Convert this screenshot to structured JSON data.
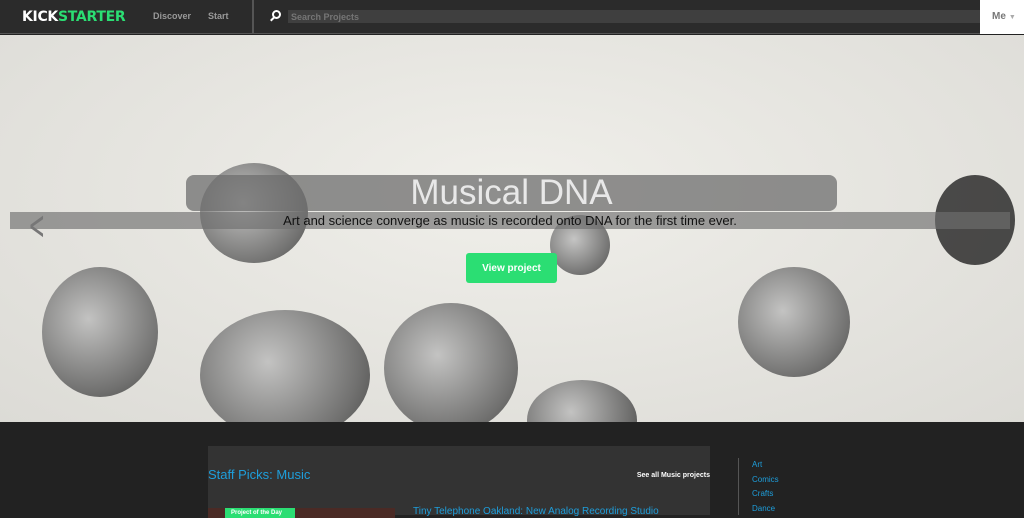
{
  "nav": {
    "logo_a": "KICK",
    "logo_b": "STARTER",
    "discover": "Discover",
    "start": "Start",
    "search_placeholder": "Search Projects",
    "me": "Me"
  },
  "hero": {
    "title": "Musical DNA",
    "subtitle": "Art and science converge as music is recorded onto DNA for the first time ever.",
    "button": "View project"
  },
  "staff": {
    "heading": "Staff Picks: Music",
    "see_all": "See all Music projects",
    "badge": "Project of the Day",
    "project_title": "Tiny Telephone Oakland: New Analog Recording Studio"
  },
  "categories": [
    "Art",
    "Comics",
    "Crafts",
    "Dance"
  ],
  "colors": {
    "brand": "#2bde73",
    "link": "#1e9edb"
  }
}
